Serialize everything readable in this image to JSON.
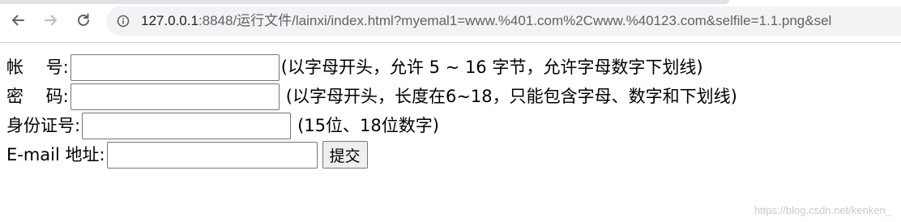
{
  "browser": {
    "url_host": "127.0.0.1",
    "url_rest": ":8848/运行文件/lainxi/index.html?myemal1=www.%401.com%2Cwww.%40123.com&selfile=1.1.png&sel"
  },
  "form": {
    "username": {
      "label": "帐　 号:",
      "value": "",
      "hint": "(以字母开头，允许 5 ~ 16 字节，允许字母数字下划线)"
    },
    "password": {
      "label": "密　 码:",
      "value": "",
      "hint": "(以字母开头，长度在6~18，只能包含字母、数字和下划线)"
    },
    "id_number": {
      "label": "身份证号:",
      "value": "",
      "hint": "(15位、18位数字)"
    },
    "email": {
      "label": "E-mail 地址:",
      "value": ""
    },
    "submit_label": "提交"
  },
  "watermark": "https://blog.csdn.net/kenken_"
}
